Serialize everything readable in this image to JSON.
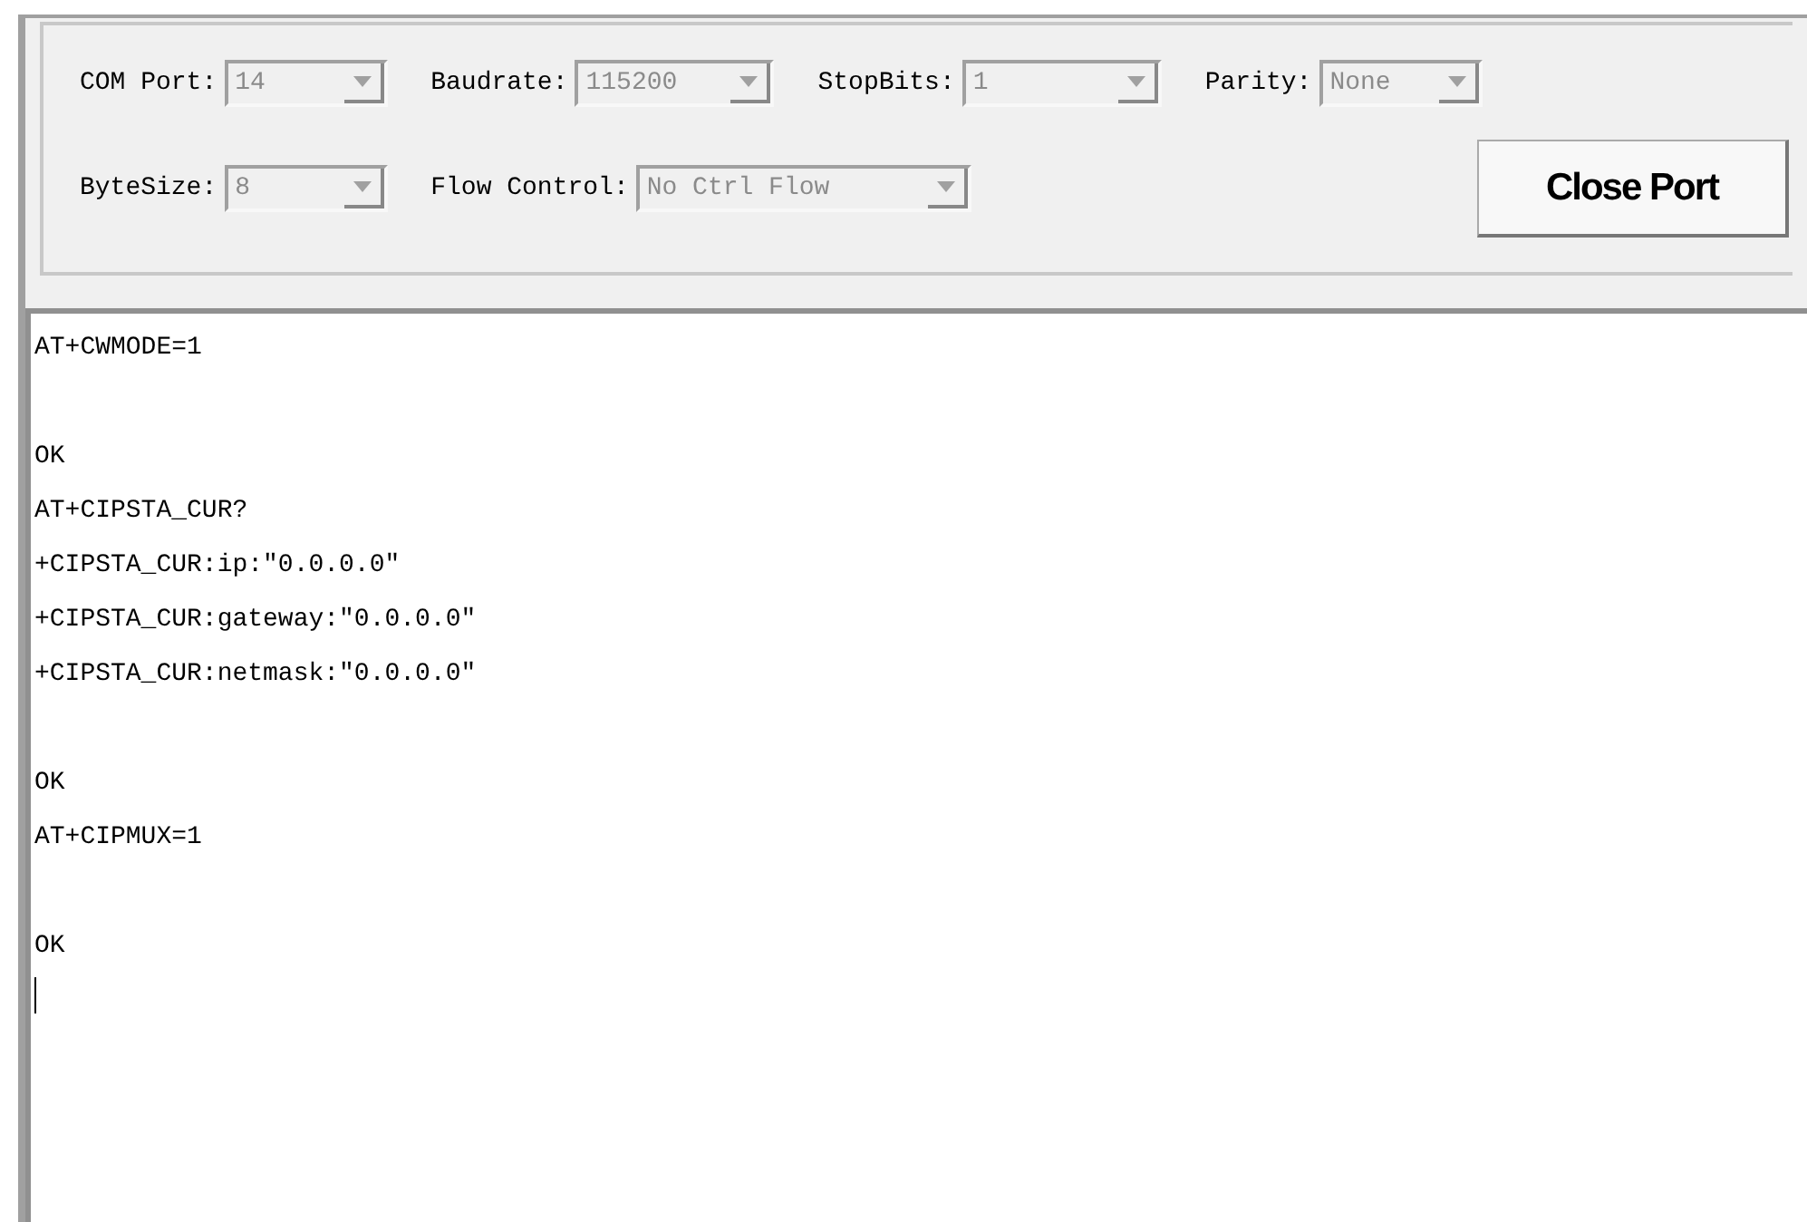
{
  "settings": {
    "rows": [
      [
        {
          "label": "COM Port:",
          "value": "14",
          "disabled": true
        },
        {
          "label": "Baudrate:",
          "value": "115200",
          "disabled": true
        },
        {
          "label": "StopBits:",
          "value": "1",
          "disabled": true
        },
        {
          "label": "Parity:",
          "value": "None",
          "disabled": true
        }
      ],
      [
        {
          "label": "ByteSize:",
          "value": "8",
          "disabled": true
        },
        {
          "label": "Flow Control:",
          "value": "No Ctrl Flow",
          "disabled": true
        }
      ]
    ],
    "button": "Close Port"
  },
  "terminal": {
    "blocks": [
      [
        "AT+CWMODE=1"
      ],
      [
        "OK",
        "AT+CIPSTA_CUR?",
        "+CIPSTA_CUR:ip:\"0.0.0.0\"",
        "+CIPSTA_CUR:gateway:\"0.0.0.0\"",
        "+CIPSTA_CUR:netmask:\"0.0.0.0\""
      ],
      [
        "OK",
        "AT+CIPMUX=1"
      ],
      [
        "OK"
      ]
    ],
    "cursor": true
  }
}
